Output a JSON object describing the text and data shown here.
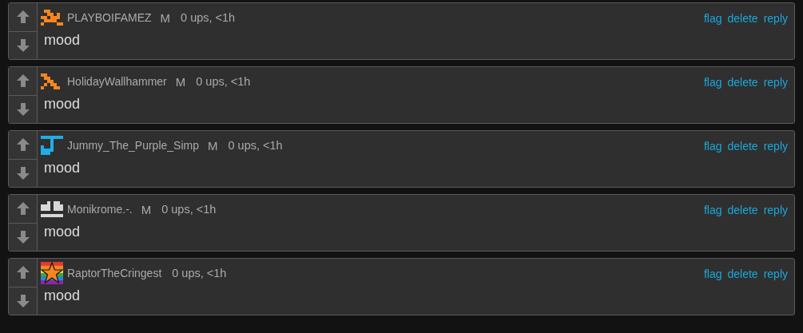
{
  "comments": [
    {
      "username": "PLAYBOIFAMEZ",
      "badge": "M",
      "meta": "0 ups, <1h",
      "text": "mood",
      "avatar": {
        "kind": "squiggle",
        "color": "#f7861e"
      },
      "actions": [
        "flag",
        "delete",
        "reply"
      ]
    },
    {
      "username": "HolidayWallhammer",
      "badge": "M",
      "meta": "0 ups, <1h",
      "text": "mood",
      "avatar": {
        "kind": "chevron",
        "color": "#f7861e"
      },
      "actions": [
        "flag",
        "delete",
        "reply"
      ]
    },
    {
      "username": "Jummy_The_Purple_Simp",
      "badge": "M",
      "meta": "0 ups, <1h",
      "text": "mood",
      "avatar": {
        "kind": "hook",
        "color": "#1eaee8"
      },
      "actions": [
        "flag",
        "delete",
        "reply"
      ]
    },
    {
      "username": "Monikrome.-.",
      "badge": "M",
      "meta": "0 ups, <1h",
      "text": "mood",
      "avatar": {
        "kind": "blocks",
        "color": "#d8d8d8"
      },
      "actions": [
        "flag",
        "delete",
        "reply"
      ]
    },
    {
      "username": "RaptorTheCringest",
      "meta": "0 ups, <1h",
      "text": "mood",
      "avatar": {
        "kind": "star",
        "color": "#f7861e"
      },
      "actions": [
        "flag",
        "delete",
        "reply"
      ]
    }
  ]
}
